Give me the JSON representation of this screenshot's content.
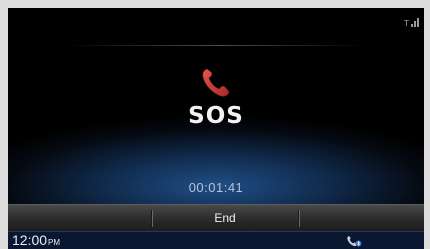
{
  "call": {
    "name": "SOS",
    "duration": "00:01:41",
    "icon": "phone-handset-icon",
    "icon_color": "#c9413c"
  },
  "buttons": {
    "end_label": "End"
  },
  "status": {
    "time": "12:00",
    "ampm": "PM",
    "signal_icon": "signal-strength-icon",
    "phone_icon": "bluetooth-phone-icon"
  }
}
